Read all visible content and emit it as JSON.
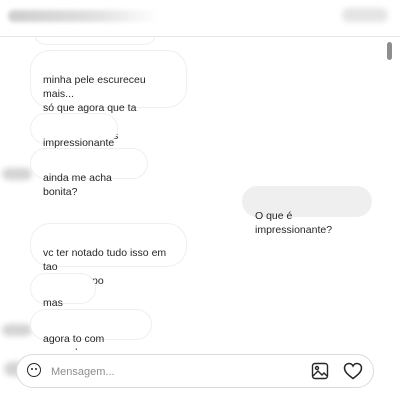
{
  "conversation": {
    "messages": [
      {
        "direction": "in",
        "text": "minha pele escureceu mais...\nsó que agora que ta voltando\nno tom de antes"
      },
      {
        "direction": "in",
        "text": "impressionante"
      },
      {
        "direction": "in",
        "text": "ainda me acha bonita?"
      },
      {
        "direction": "out",
        "text": "O que é impressionante?"
      },
      {
        "direction": "in",
        "text": "vc ter notado tudo isso em tao\npouco tempo"
      },
      {
        "direction": "in",
        "text": "mas enfim"
      },
      {
        "direction": "in",
        "text": "agora to com vergonha"
      }
    ]
  },
  "composer": {
    "placeholder": "Mensagem...",
    "emoji_icon": "emoji-icon",
    "image_icon": "image-icon",
    "heart_icon": "heart-icon"
  },
  "colors": {
    "incoming_bubble_border": "#efefef",
    "outgoing_bubble_bg": "#efefef",
    "text": "#262626",
    "placeholder": "#8e8e8e"
  }
}
